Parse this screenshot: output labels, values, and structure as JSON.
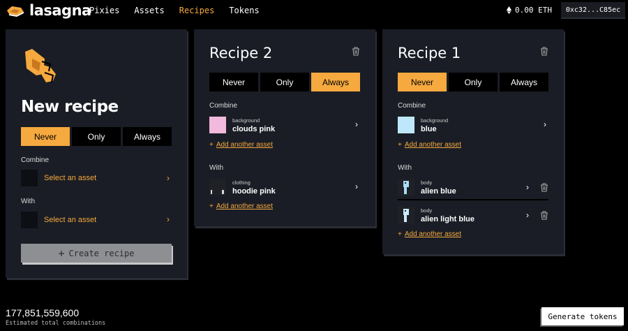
{
  "app": {
    "name": "lasagna"
  },
  "nav": {
    "items": [
      "Pixies",
      "Assets",
      "Recipes",
      "Tokens"
    ],
    "active": "Recipes"
  },
  "wallet": {
    "balance": "0.00 ETH",
    "address": "0xc32...C85ec"
  },
  "new_recipe": {
    "title": "New recipe",
    "options": [
      "Never",
      "Only",
      "Always"
    ],
    "selected": "Never",
    "combine_label": "Combine",
    "with_label": "With",
    "combine_placeholder": "Select an asset",
    "with_placeholder": "Select an asset",
    "create_label": "Create recipe"
  },
  "recipe2": {
    "title": "Recipe 2",
    "options": [
      "Never",
      "Only",
      "Always"
    ],
    "selected": "Always",
    "combine_label": "Combine",
    "combine": {
      "category": "background",
      "name": "clouds pink",
      "color": "#f2b9de"
    },
    "add_label": "Add another asset",
    "with_label": "With",
    "with": {
      "category": "clothing",
      "name": "hoodie pink"
    },
    "add_label_2": "Add another asset"
  },
  "recipe1": {
    "title": "Recipe 1",
    "options": [
      "Never",
      "Only",
      "Always"
    ],
    "selected": "Never",
    "combine_label": "Combine",
    "combine": {
      "category": "background",
      "name": "blue",
      "color": "#bfe7fb"
    },
    "add_label": "Add another asset",
    "with_label": "With",
    "with": [
      {
        "category": "body",
        "name": "alien blue"
      },
      {
        "category": "body",
        "name": "alien light blue"
      }
    ],
    "add_label_2": "Add another asset"
  },
  "footer": {
    "total": "177,851,559,600",
    "total_label": "Estimated total combinations",
    "generate_label": "Generate tokens"
  },
  "colors": {
    "accent": "#f5a93f",
    "panel": "#1a1d25",
    "background": "#000000"
  }
}
